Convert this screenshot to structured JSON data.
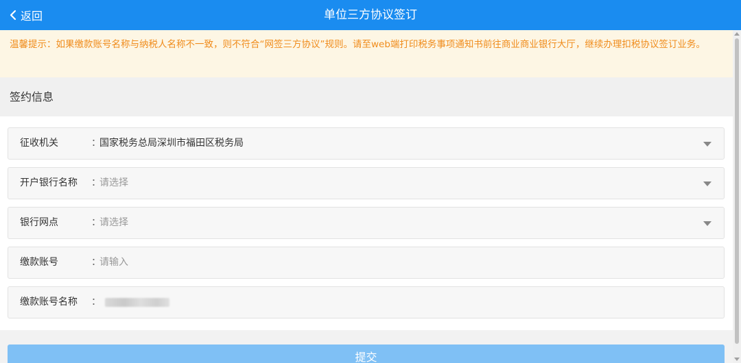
{
  "header": {
    "back_label": "返回",
    "title": "单位三方协议签订",
    "accent_color": "#1a8cf0"
  },
  "notice": {
    "text": "温馨提示：如果缴款账号名称与纳税人名称不一致，则不符合“网签三方协议”规则。请至web端打印税务事项通知书前往商业商业银行大厅，继续办理扣税协议签订业务。",
    "color": "#f08c1c"
  },
  "section": {
    "title": "签约信息"
  },
  "form": {
    "rows": [
      {
        "label": "征收机关",
        "colon": "：",
        "value": "国家税务总局深圳市福田区税务局",
        "type": "select"
      },
      {
        "label": "开户银行名称",
        "colon": "：",
        "placeholder": "请选择",
        "type": "select"
      },
      {
        "label": "银行网点",
        "colon": "：",
        "placeholder": "请选择",
        "type": "select"
      },
      {
        "label": "缴款账号",
        "colon": "：",
        "placeholder": "请输入",
        "type": "input"
      },
      {
        "label": "缴款账号名称",
        "colon": "：",
        "value_redacted": true,
        "type": "readonly"
      }
    ]
  },
  "actions": {
    "submit_label": "提交"
  },
  "icons": {
    "back": "chevron-left-icon",
    "dropdown": "caret-down-icon"
  }
}
